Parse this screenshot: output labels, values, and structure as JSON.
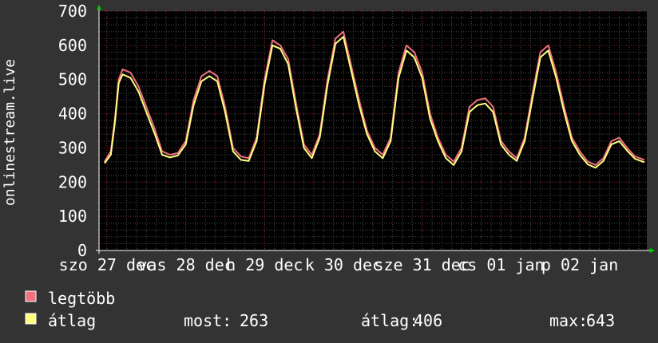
{
  "chart_data": {
    "type": "line",
    "ylabel": "onlinestream.live",
    "ylim": [
      0,
      700
    ],
    "yticks": [
      0,
      100,
      200,
      300,
      400,
      500,
      600,
      700
    ],
    "xticks": [
      {
        "label": "szo 27 dec",
        "x": 0.0
      },
      {
        "label": "vas 28 dec",
        "x": 1.0
      },
      {
        "label": "h 29 dec",
        "x": 2.0
      },
      {
        "label": "k 30 dec",
        "x": 3.0
      },
      {
        "label": "sze 31 dec",
        "x": 4.0
      },
      {
        "label": "cs 01 jan",
        "x": 5.0
      },
      {
        "label": "p 02 jan",
        "x": 6.0
      }
    ],
    "xlim": [
      -0.1,
      6.85
    ],
    "grid": true,
    "colors": {
      "background": "#333333",
      "plot": "#000000",
      "grid_major": "#8a2f2f",
      "grid_minor": "#4a4a4a",
      "max": "#f07080",
      "avg": "#ffff80",
      "text": "#ffffff",
      "axis": "#ffffff",
      "arrow": "#00cc00"
    },
    "series": [
      {
        "name": "legtöbb",
        "color": "#f07080",
        "x": [
          -0.03,
          0.05,
          0.1,
          0.15,
          0.2,
          0.3,
          0.4,
          0.5,
          0.6,
          0.7,
          0.8,
          0.9,
          1.0,
          1.1,
          1.2,
          1.3,
          1.4,
          1.5,
          1.6,
          1.7,
          1.8,
          1.9,
          2.0,
          2.1,
          2.2,
          2.3,
          2.4,
          2.5,
          2.6,
          2.7,
          2.8,
          2.9,
          3.0,
          3.1,
          3.2,
          3.3,
          3.4,
          3.5,
          3.6,
          3.7,
          3.8,
          3.9,
          4.0,
          4.1,
          4.2,
          4.3,
          4.4,
          4.5,
          4.6,
          4.7,
          4.8,
          4.9,
          5.0,
          5.1,
          5.2,
          5.3,
          5.4,
          5.5,
          5.6,
          5.7,
          5.8,
          5.9,
          6.0,
          6.1,
          6.2,
          6.3,
          6.4,
          6.5,
          6.6,
          6.7,
          6.82
        ],
        "values": [
          260,
          290,
          380,
          500,
          530,
          520,
          480,
          420,
          360,
          290,
          280,
          285,
          320,
          440,
          510,
          525,
          510,
          420,
          300,
          275,
          270,
          330,
          500,
          615,
          600,
          560,
          430,
          310,
          280,
          340,
          500,
          620,
          640,
          540,
          440,
          350,
          300,
          280,
          330,
          520,
          600,
          580,
          520,
          400,
          330,
          280,
          260,
          300,
          420,
          440,
          445,
          420,
          320,
          290,
          270,
          330,
          460,
          580,
          600,
          520,
          420,
          330,
          290,
          260,
          250,
          270,
          320,
          330,
          300,
          275,
          265
        ]
      },
      {
        "name": "átlag",
        "color": "#ffff80",
        "x": [
          -0.03,
          0.05,
          0.1,
          0.15,
          0.2,
          0.3,
          0.4,
          0.5,
          0.6,
          0.7,
          0.8,
          0.9,
          1.0,
          1.1,
          1.2,
          1.3,
          1.4,
          1.5,
          1.6,
          1.7,
          1.8,
          1.9,
          2.0,
          2.1,
          2.2,
          2.3,
          2.4,
          2.5,
          2.6,
          2.7,
          2.8,
          2.9,
          3.0,
          3.1,
          3.2,
          3.3,
          3.4,
          3.5,
          3.6,
          3.7,
          3.8,
          3.9,
          4.0,
          4.1,
          4.2,
          4.3,
          4.4,
          4.5,
          4.6,
          4.7,
          4.8,
          4.9,
          5.0,
          5.1,
          5.2,
          5.3,
          5.4,
          5.5,
          5.6,
          5.7,
          5.8,
          5.9,
          6.0,
          6.1,
          6.2,
          6.3,
          6.4,
          6.5,
          6.6,
          6.7,
          6.82
        ],
        "values": [
          255,
          280,
          370,
          490,
          515,
          505,
          465,
          405,
          345,
          280,
          272,
          278,
          310,
          425,
          495,
          510,
          495,
          405,
          290,
          265,
          262,
          320,
          485,
          600,
          590,
          545,
          415,
          300,
          270,
          330,
          485,
          605,
          625,
          525,
          425,
          340,
          290,
          270,
          320,
          505,
          585,
          565,
          505,
          385,
          320,
          270,
          250,
          290,
          405,
          425,
          430,
          405,
          310,
          280,
          262,
          320,
          445,
          565,
          585,
          505,
          405,
          320,
          280,
          252,
          242,
          262,
          310,
          320,
          292,
          268,
          258
        ]
      }
    ],
    "legend": {
      "items": [
        {
          "label": "legtöbb",
          "color": "#f07080"
        },
        {
          "label": "átlag",
          "color": "#ffff80"
        }
      ],
      "stats": [
        {
          "label": "most:",
          "value": "263"
        },
        {
          "label": "átlag:",
          "value": "406"
        },
        {
          "label": "max:",
          "value": "643"
        }
      ]
    }
  }
}
